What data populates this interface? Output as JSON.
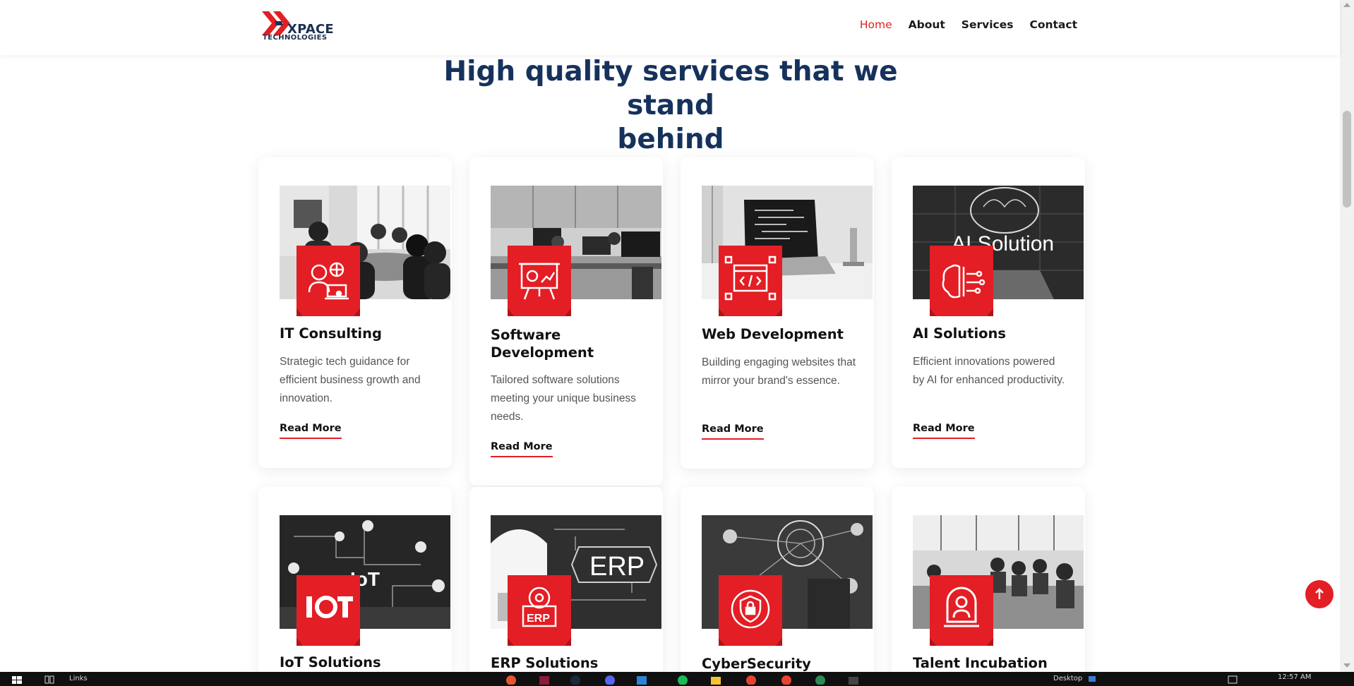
{
  "header": {
    "logo_word": "XPACE",
    "logo_sub": "TECHNOLOGIES",
    "nav": [
      {
        "label": "Home",
        "active": true
      },
      {
        "label": "About",
        "active": false
      },
      {
        "label": "Services",
        "active": false
      },
      {
        "label": "Contact",
        "active": false
      }
    ]
  },
  "section": {
    "title_line1": "High quality services that we stand",
    "title_line2": "behind"
  },
  "cards": [
    {
      "title": "IT Consulting",
      "desc": "Strategic tech guidance for efficient business growth and innovation.",
      "link": "Read More",
      "icon": "consultant-icon"
    },
    {
      "title": "Software Development",
      "desc": "Tailored software solutions meeting your unique business needs.",
      "link": "Read More",
      "icon": "presentation-board-icon"
    },
    {
      "title": "Web Development",
      "desc": "Building engaging websites that mirror your brand's essence.",
      "link": "Read More",
      "icon": "web-code-icon"
    },
    {
      "title": "AI Solutions",
      "desc": "Efficient innovations powered by AI for enhanced productivity.",
      "link": "Read More",
      "icon": "ai-brain-icon",
      "image_text": "AI Solution"
    },
    {
      "title": "IoT Solutions",
      "icon": "iot-icon",
      "image_text": "IoT"
    },
    {
      "title": "ERP Solutions",
      "icon": "erp-icon",
      "image_text": "ERP"
    },
    {
      "title": "CyberSecurity",
      "icon": "security-lock-icon"
    },
    {
      "title": "Talent Incubation",
      "icon": "talent-person-icon"
    }
  ],
  "taskbar": {
    "links_label": "Links",
    "desktop_label": "Desktop",
    "time": "12:57 AM"
  },
  "colors": {
    "accent": "#e31e24",
    "heading": "#16325c"
  }
}
